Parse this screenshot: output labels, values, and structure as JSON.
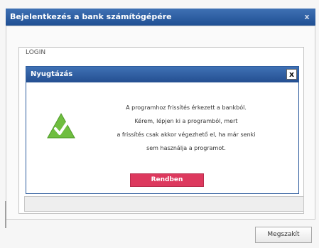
{
  "window": {
    "title": "Bejelentkezés a bank számítógépére",
    "close_label": "x"
  },
  "login": {
    "label": "LOGIN"
  },
  "dialog": {
    "title": "Nyugtázás",
    "close_label": "x",
    "message_lines": [
      "A programhoz frissítés érkezett a bankból.",
      "Kérem, lépjen ki a programból, mert",
      "a frissítés csak akkor végezhető el, ha már senki",
      "sem használja a programot."
    ],
    "ok_label": "Rendben",
    "icon": "warning-check-icon"
  },
  "footer": {
    "cancel_label": "Megszakít"
  },
  "colors": {
    "title_bar": "#2f5d9e",
    "ok_button": "#dd395e",
    "icon_green": "#6fbe3f"
  }
}
